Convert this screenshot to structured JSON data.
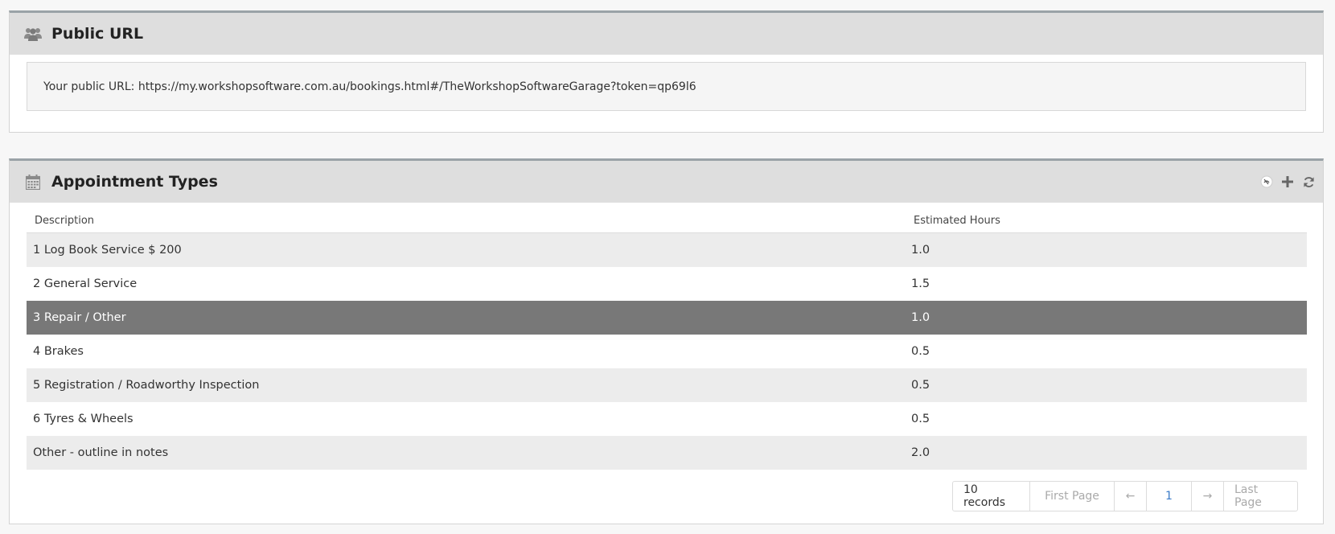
{
  "public_url": {
    "title": "Public URL",
    "icon": "users-icon",
    "text": "Your public URL: https://my.workshopsoftware.com.au/bookings.html#/TheWorkshopSoftwareGarage?token=qp69l6"
  },
  "appointment_types": {
    "title": "Appointment Types",
    "icon": "calendar-icon",
    "tools": [
      "eye-off-icon",
      "plus-icon",
      "refresh-icon"
    ],
    "columns": {
      "description": "Description",
      "hours": "Estimated Hours"
    },
    "rows": [
      {
        "description": "1 Log Book Service $ 200",
        "hours": "1.0"
      },
      {
        "description": "2 General Service",
        "hours": "1.5"
      },
      {
        "description": "3 Repair / Other",
        "hours": "1.0",
        "selected": true
      },
      {
        "description": "4 Brakes",
        "hours": "0.5"
      },
      {
        "description": "5 Registration / Roadworthy Inspection",
        "hours": "0.5"
      },
      {
        "description": "6 Tyres & Wheels",
        "hours": "0.5"
      },
      {
        "description": "Other - outline in notes",
        "hours": "2.0"
      }
    ],
    "pager": {
      "records": "10 records",
      "first": "First Page",
      "prev": "←",
      "page": "1",
      "next": "→",
      "last": "Last Page"
    }
  },
  "colors": {
    "header_bg": "#dedede",
    "selected_row": "#787878",
    "page_link": "#3a7bc8"
  }
}
